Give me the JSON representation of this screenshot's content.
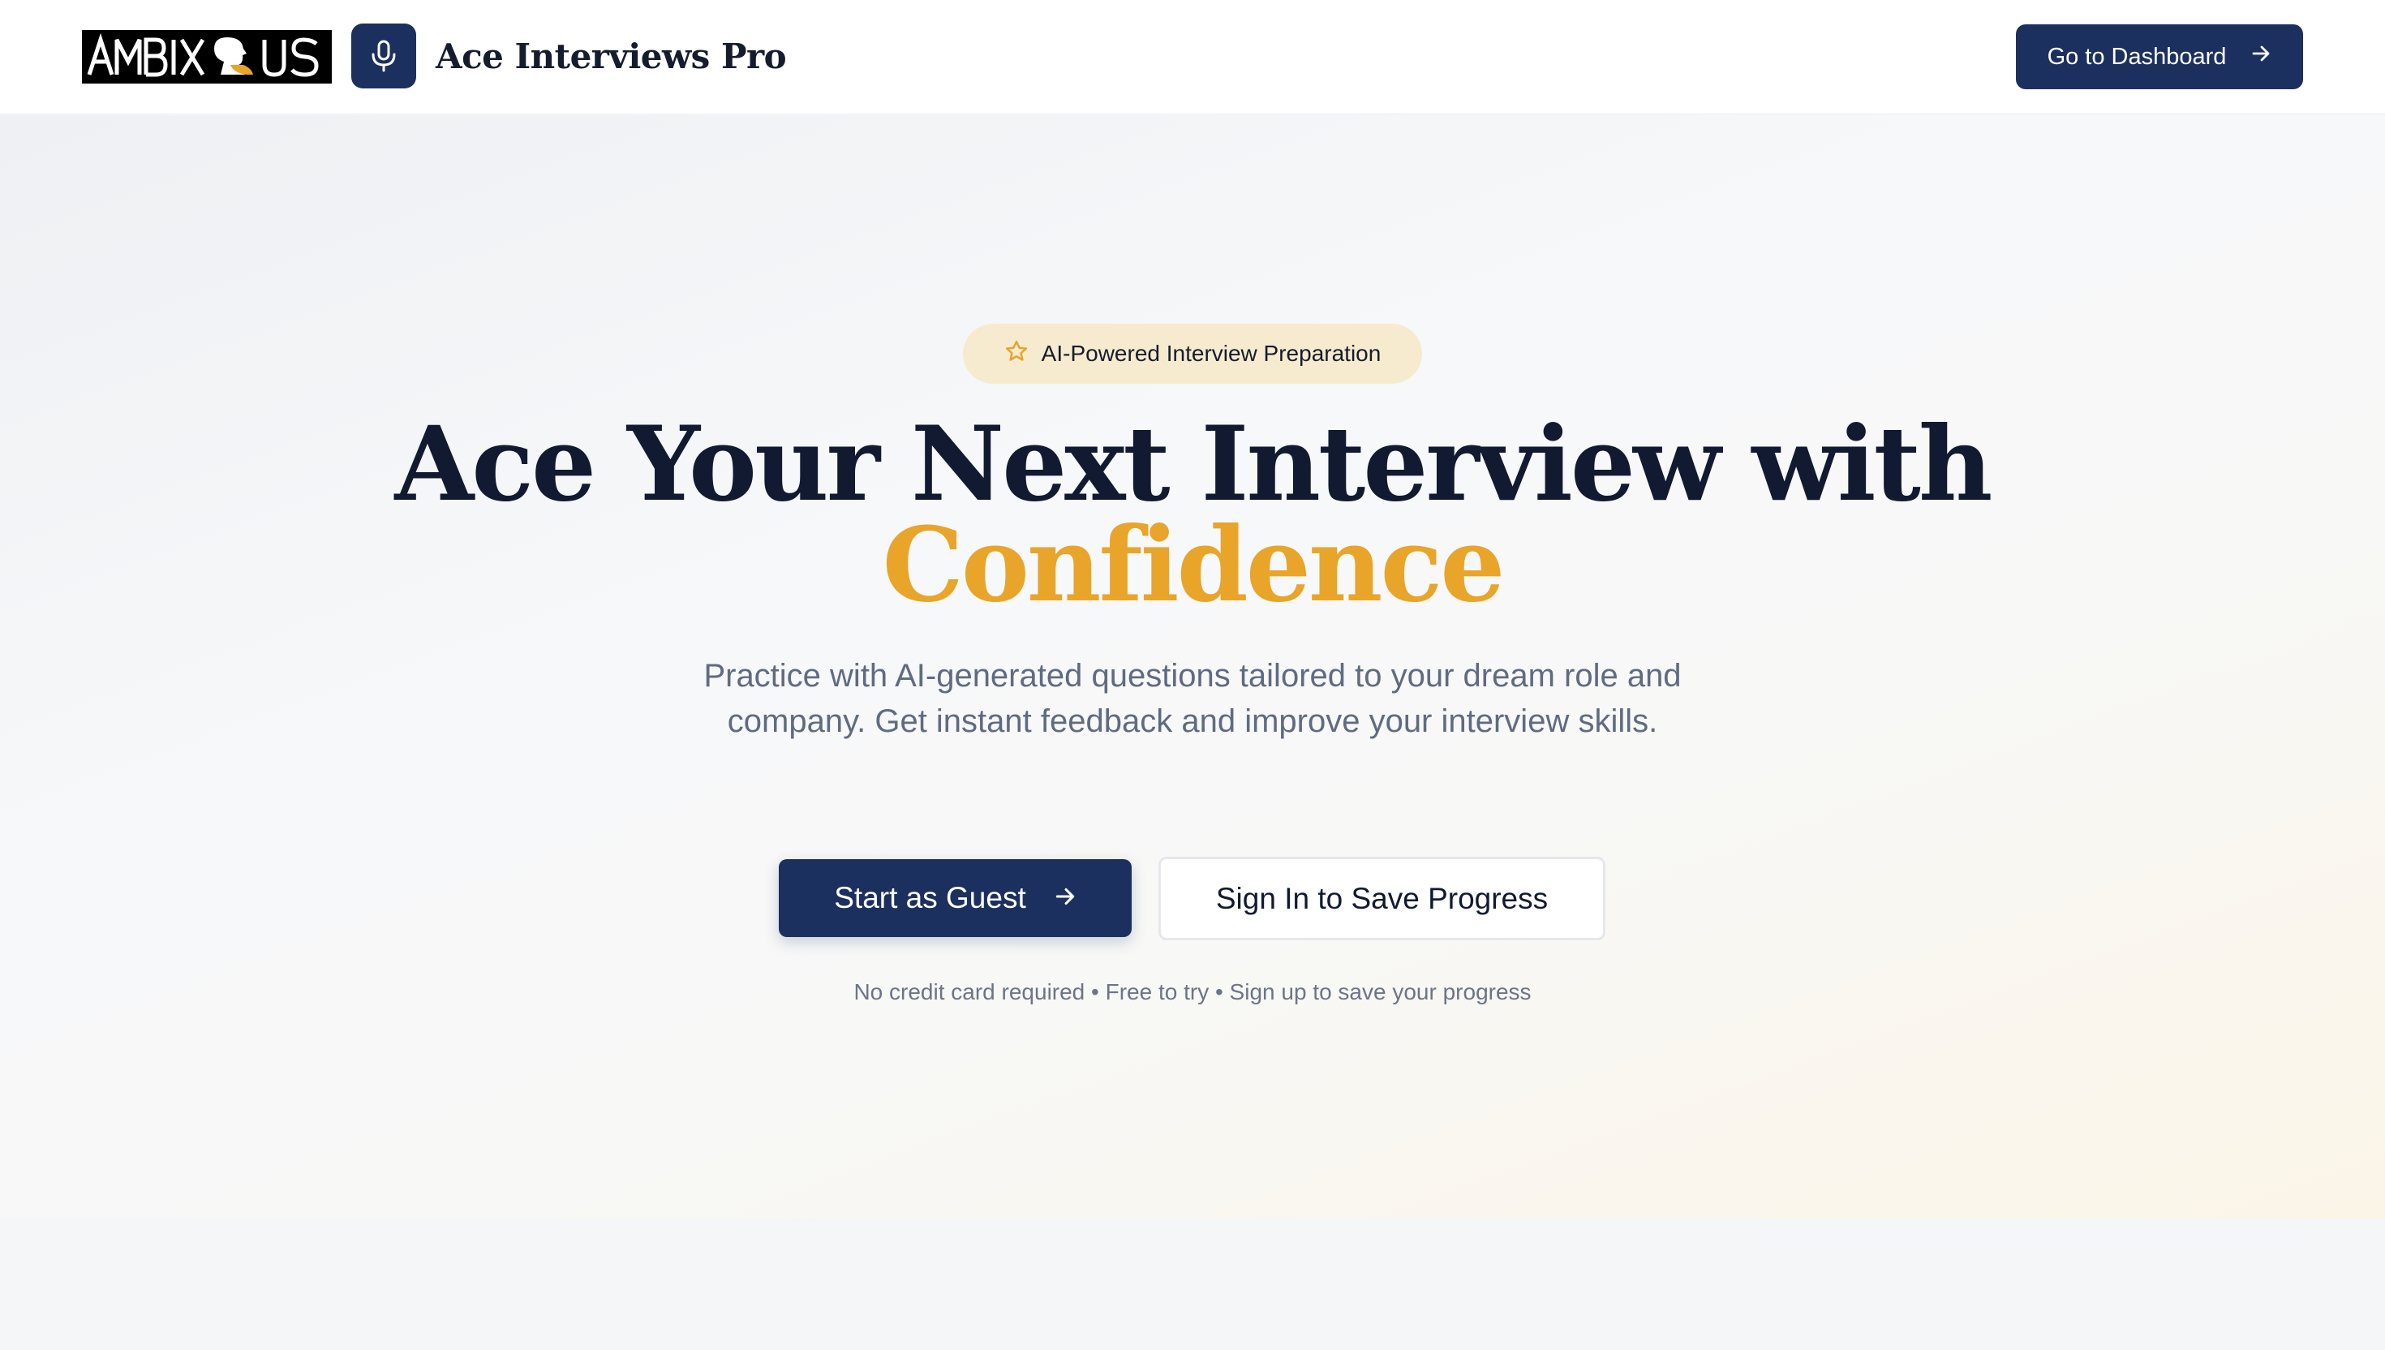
{
  "header": {
    "logo_text": "AMBIXOUS",
    "brand": "Ace Interviews Pro",
    "dashboard_label": "Go to Dashboard"
  },
  "hero": {
    "badge": "AI-Powered Interview Preparation",
    "headline_line1": "Ace Your Next Interview with",
    "headline_accent": "Confidence",
    "subtitle": "Practice with AI-generated questions tailored to your dream role and company. Get instant feedback and improve your interview skills.",
    "primary_cta": "Start as Guest",
    "secondary_cta": "Sign In to Save Progress",
    "note": "No credit card required • Free to try • Sign up to save your progress"
  },
  "icons": {
    "logo": "ambixous-logo",
    "brand": "microphone-icon",
    "dashboard": "arrow-right-icon",
    "badge": "star-icon",
    "primary_cta": "arrow-right-icon"
  },
  "colors": {
    "navy": "#1c305f",
    "accent_gold": "#e8a52a",
    "badge_bg": "#f7ebcf"
  }
}
